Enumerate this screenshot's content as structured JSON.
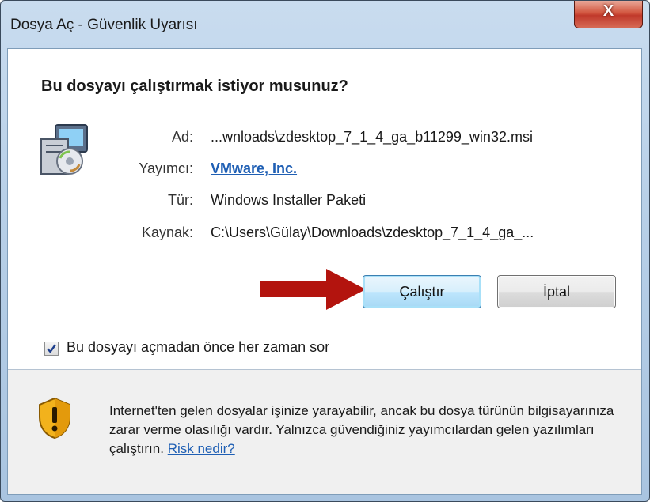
{
  "window": {
    "title": "Dosya Aç - Güvenlik Uyarısı",
    "close_glyph": "X"
  },
  "question": "Bu dosyayı çalıştırmak istiyor musunuz?",
  "details": {
    "name_label": "Ad:",
    "name_value": "...wnloads\\zdesktop_7_1_4_ga_b11299_win32.msi",
    "publisher_label": "Yayımcı:",
    "publisher_value": "VMware, Inc.",
    "type_label": "Tür:",
    "type_value": "Windows Installer Paketi",
    "source_label": "Kaynak:",
    "source_value": "C:\\Users\\Gülay\\Downloads\\zdesktop_7_1_4_ga_..."
  },
  "buttons": {
    "run_label": "Çalıştır",
    "cancel_label": "İptal"
  },
  "checkbox": {
    "label": "Bu dosyayı açmadan önce her zaman sor",
    "checked": true
  },
  "warning": {
    "text": "Internet'ten gelen dosyalar işinize yarayabilir, ancak bu dosya türünün bilgisayarınıza zarar verme olasılığı vardır. Yalnızca güvendiğiniz yayımcılardan gelen yazılımları çalıştırın.",
    "link_label": "Risk nedir?"
  },
  "icons": {
    "installer": "installer-package-icon",
    "shield": "warning-shield-icon",
    "arrow": "red-arrow-icon"
  },
  "colors": {
    "link": "#1f5fb4",
    "arrow": "#b3140e",
    "close_button": "#c0392b"
  }
}
